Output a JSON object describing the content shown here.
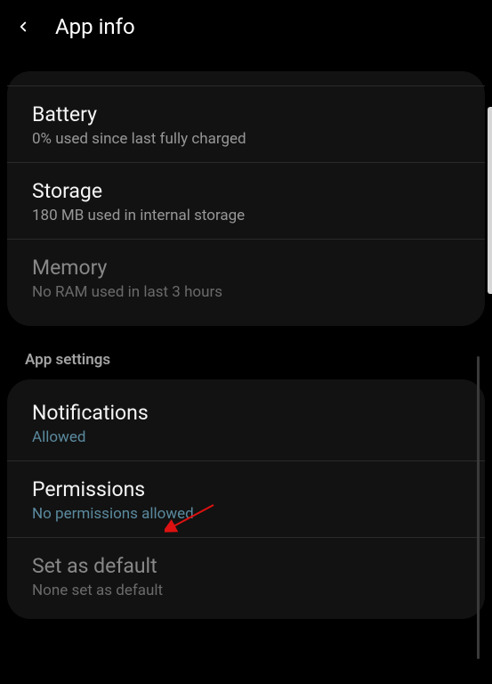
{
  "header": {
    "title": "App info"
  },
  "usage": {
    "battery": {
      "title": "Battery",
      "sub": "0% used since last fully charged"
    },
    "storage": {
      "title": "Storage",
      "sub": "180 MB used in internal storage"
    },
    "memory": {
      "title": "Memory",
      "sub": "No RAM used in last 3 hours"
    }
  },
  "section": {
    "app_settings": "App settings"
  },
  "settings": {
    "notifications": {
      "title": "Notifications",
      "sub": "Allowed"
    },
    "permissions": {
      "title": "Permissions",
      "sub": "No permissions allowed"
    },
    "set_default": {
      "title": "Set as default",
      "sub": "None set as default"
    }
  }
}
